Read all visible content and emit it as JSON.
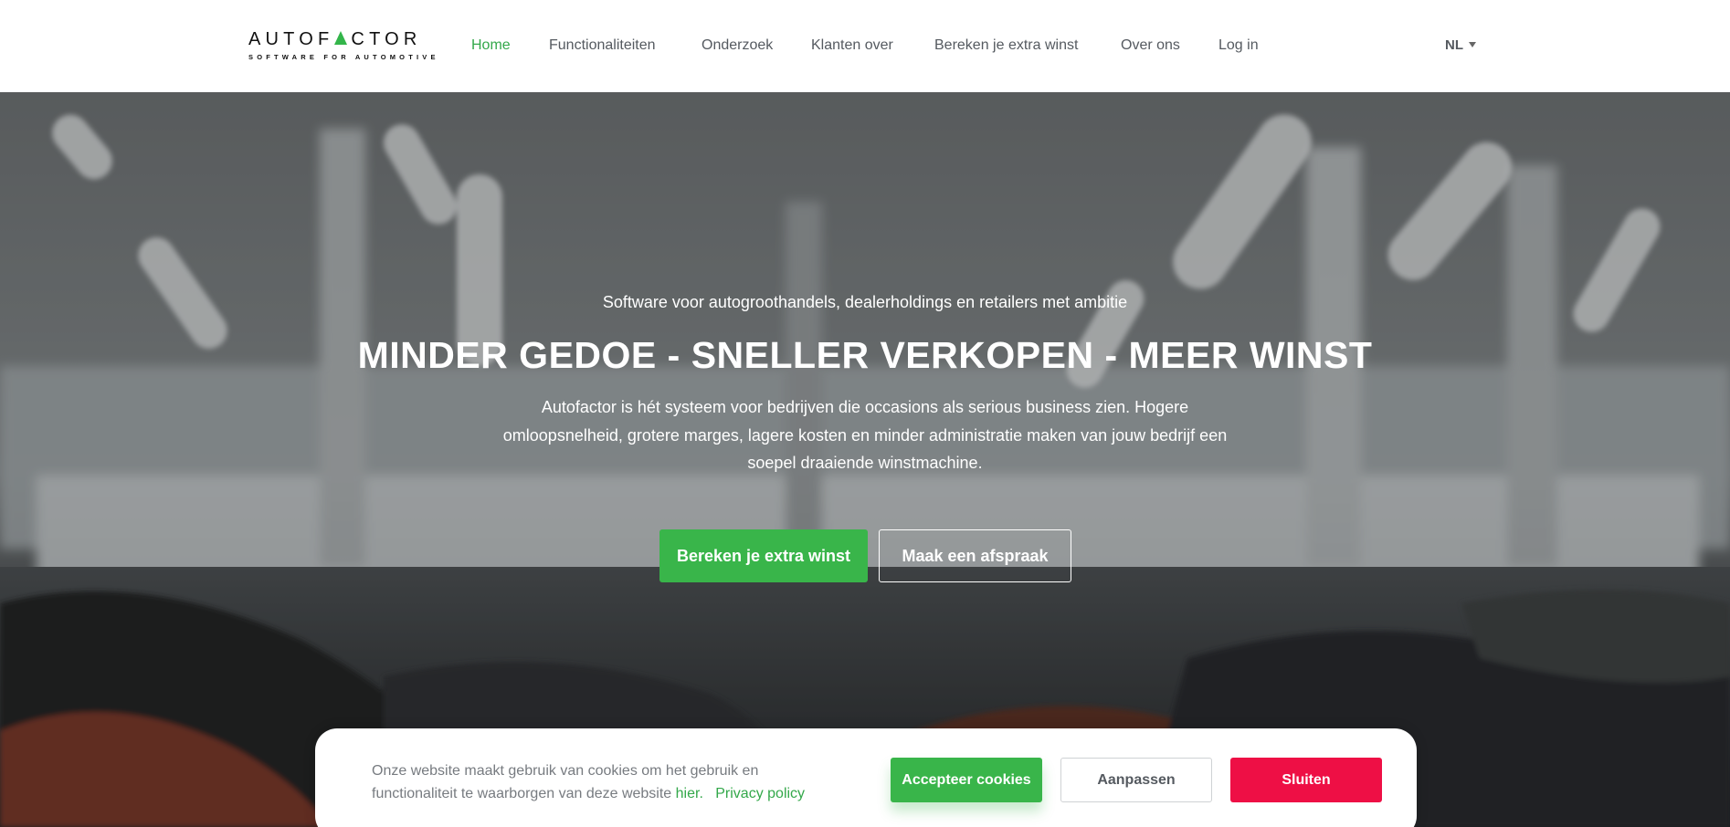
{
  "header": {
    "logo": {
      "part1": "AUTOF",
      "part2": "CTOR",
      "tagline": "SOFTWARE FOR AUTOMOTIVE",
      "accent_color": "#33b54a"
    },
    "nav": [
      {
        "label": "Home",
        "active": true
      },
      {
        "label": "Functionaliteiten",
        "active": false
      },
      {
        "label": "Onderzoek",
        "active": false
      },
      {
        "label": "Klanten over",
        "active": false
      },
      {
        "label": "Bereken je extra winst",
        "active": false
      },
      {
        "label": "Over ons",
        "active": false
      },
      {
        "label": "Log in",
        "active": false
      }
    ],
    "language": "NL"
  },
  "hero": {
    "kicker": "Software voor autogroothandels, dealerholdings en retailers met ambitie",
    "title": "MINDER GEDOE - SNELLER VERKOPEN - MEER WINST",
    "text": "Autofactor is hét systeem voor bedrijven die occasions als serious business zien. Hogere omloopsnelheid, grotere marges, lagere kosten en minder administratie maken van jouw bedrijf een soepel draaiende winstmachine.",
    "primary_button": "Bereken je extra winst",
    "secondary_button": "Maak een afspraak"
  },
  "cookie": {
    "text": "Onze website maakt gebruik van cookies om het gebruik en functionaliteit te waarborgen van deze website",
    "link_label": "hier.",
    "privacy_label": "Privacy policy",
    "accept_label": "Accepteer cookies",
    "adjust_label": "Aanpassen",
    "close_label": "Sluiten"
  },
  "colors": {
    "brand_green": "#39b54a",
    "close_red": "#ee0f45",
    "nav_text": "#555a60"
  }
}
